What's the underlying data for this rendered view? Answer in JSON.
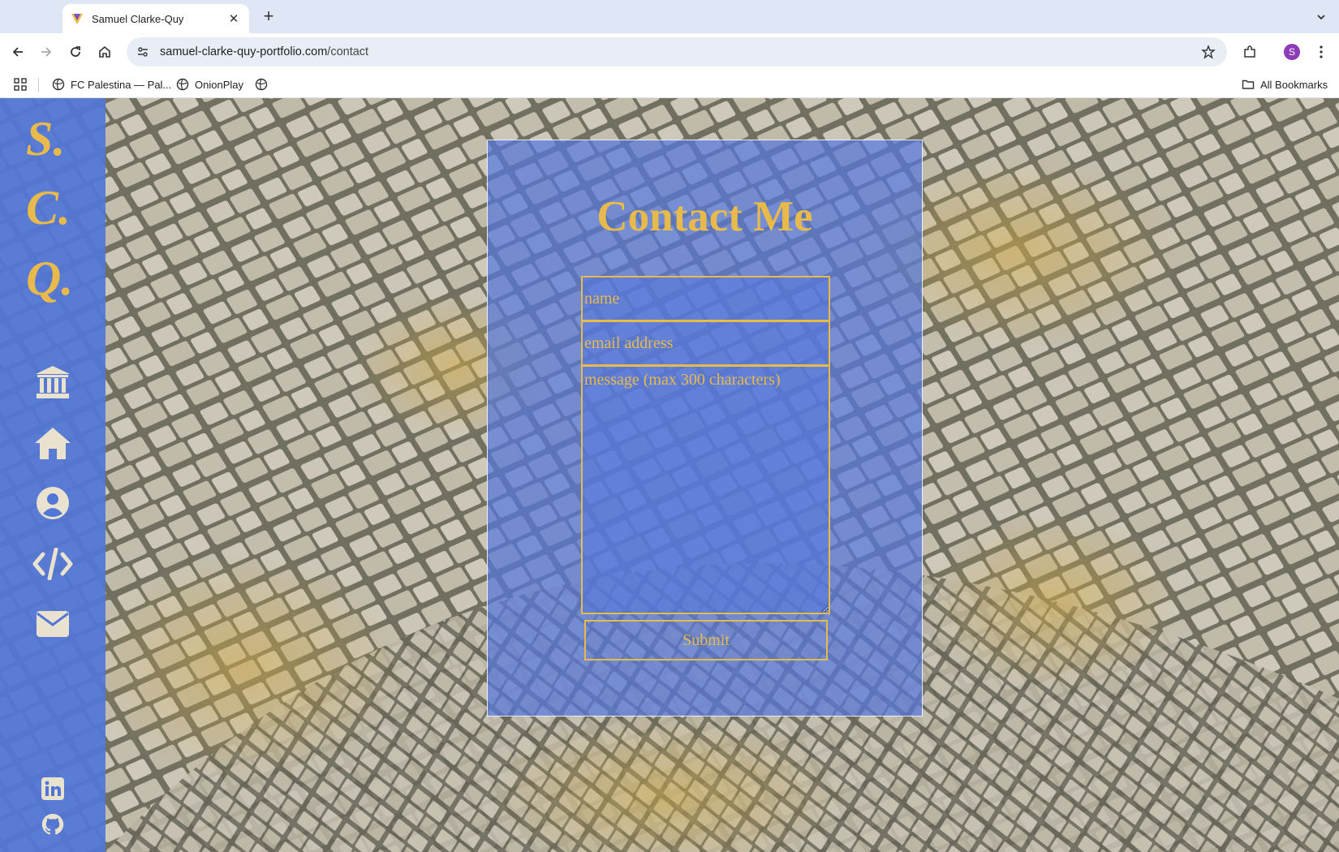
{
  "browser": {
    "tab_title": "Samuel Clarke-Quy",
    "url_domain": "samuel-clarke-quy-portfolio.com",
    "url_path": "/contact",
    "profile_initial": "S",
    "bookmarks": [
      {
        "label": "FC Palestina — Pal..."
      },
      {
        "label": "OnionPlay"
      },
      {
        "label": ""
      }
    ],
    "all_bookmarks_label": "All Bookmarks"
  },
  "sidebar": {
    "logo_letters": [
      "S.",
      "C.",
      "Q."
    ],
    "nav_icons": [
      "institution-icon",
      "home-icon",
      "user-icon",
      "code-icon",
      "envelope-icon"
    ],
    "social_icons": [
      "linkedin-icon",
      "github-icon"
    ]
  },
  "contact": {
    "heading": "Contact Me",
    "name_placeholder": "name",
    "email_placeholder": "email address",
    "message_placeholder": "message (max 300 characters)",
    "submit_label": "Submit"
  },
  "colors": {
    "accent_gold": "#e8b94b",
    "sidebar_blue": "#5276d7",
    "panel_blue": "#5678dc"
  }
}
